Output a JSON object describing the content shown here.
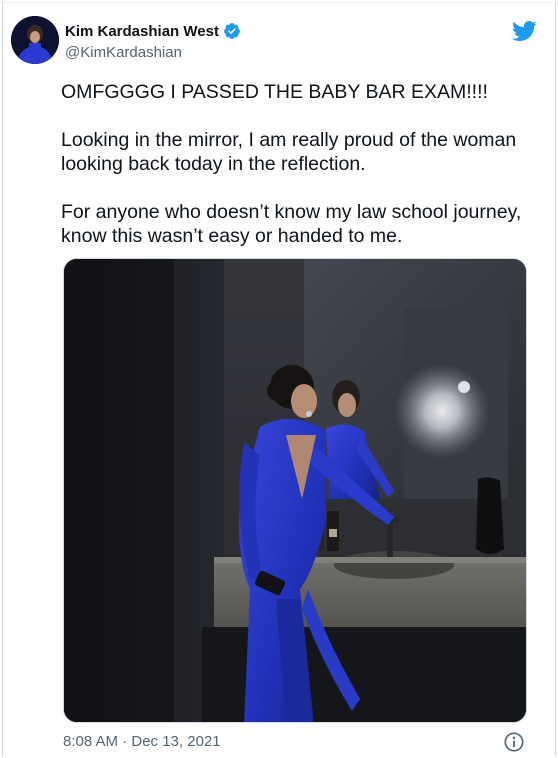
{
  "author": {
    "display_name": "Kim Kardashian West",
    "handle": "@KimKardashian"
  },
  "tweet": {
    "paragraphs": [
      "OMFGGGG I PASSED THE BABY BAR EXAM!!!!",
      "Looking in the mirror, I am really proud of the woman looking back today in the reflection.",
      "For anyone who doesn’t know my law school journey, know this wasn’t easy or handed to me."
    ],
    "timestamp": "8:08 AM · Dec 13, 2021"
  },
  "icons": {
    "verified": "verified-badge-icon",
    "brand": "twitter-bird-icon",
    "info": "info-icon"
  },
  "colors": {
    "twitter_blue": "#1d9bf0",
    "secondary_text": "#536471",
    "dress_blue": "#2f3fd8"
  }
}
